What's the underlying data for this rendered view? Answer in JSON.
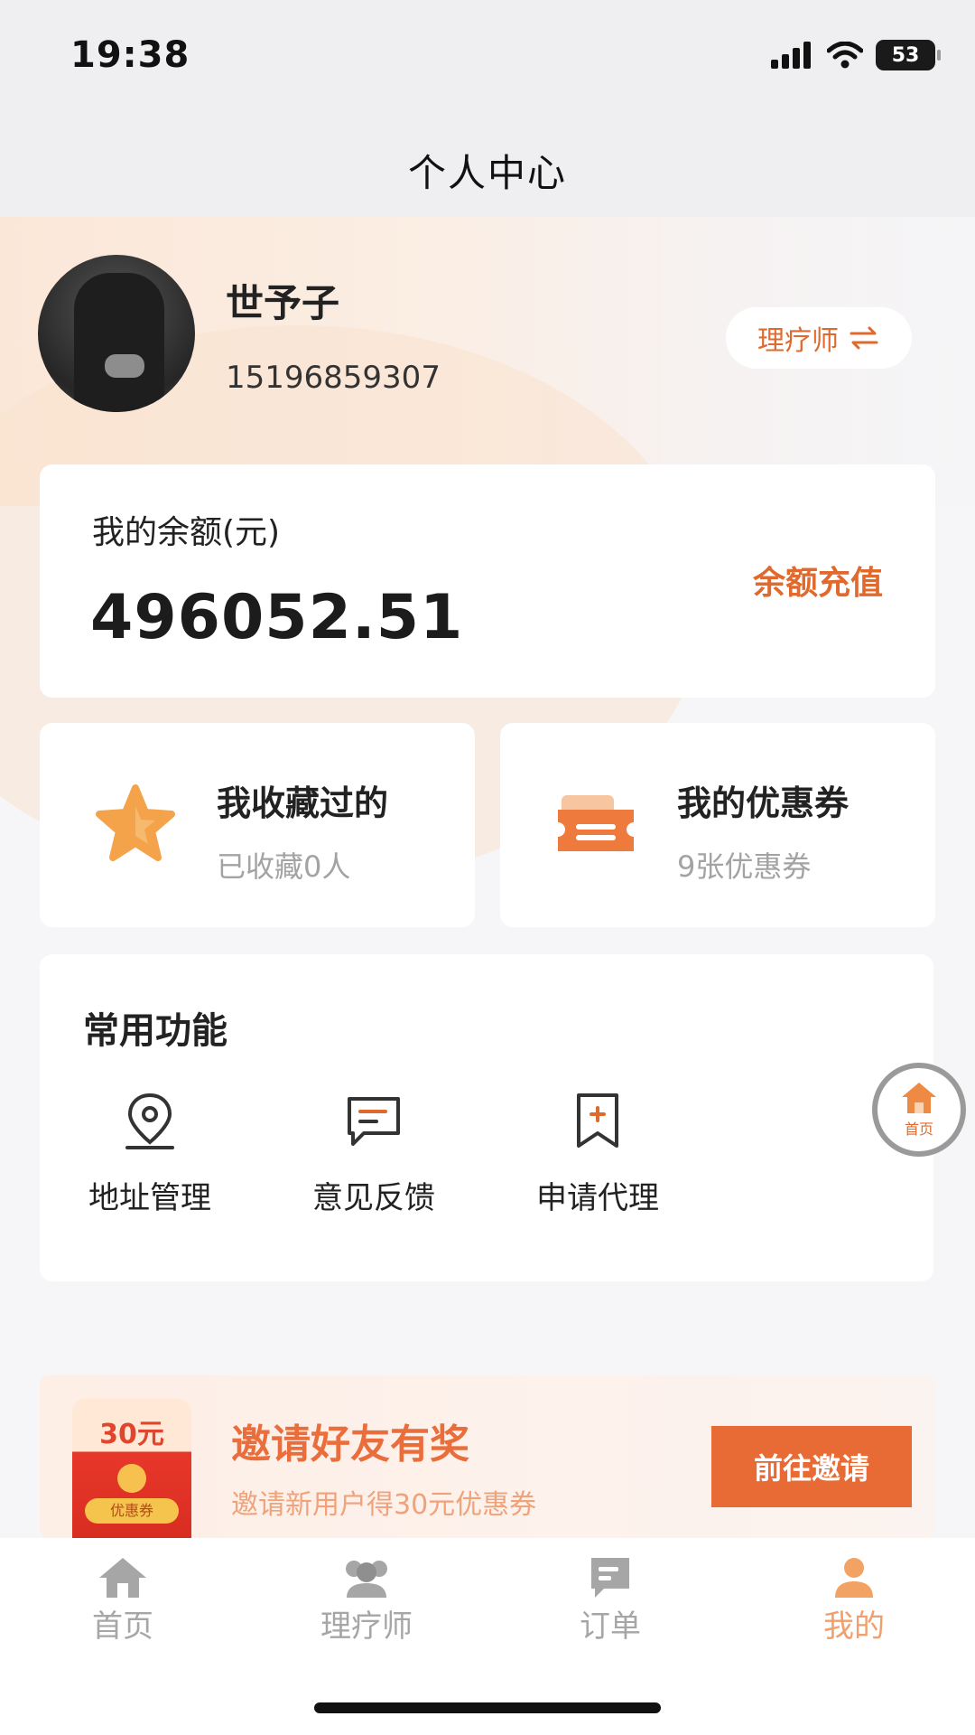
{
  "status_bar": {
    "time": "19:38",
    "battery": "53",
    "icons": [
      "cellular-signal-icon",
      "wifi-icon",
      "battery-icon"
    ]
  },
  "nav": {
    "title": "个人中心"
  },
  "profile": {
    "name": "世予子",
    "phone": "15196859307",
    "role_label": "理疗师",
    "role_icon": "swap-icon"
  },
  "balance": {
    "label": "我的余额(元)",
    "value": "496052.51",
    "recharge_label": "余额充值"
  },
  "favorites": {
    "title": "我收藏过的",
    "subtitle": "已收藏0人",
    "icon": "star-icon"
  },
  "coupons": {
    "title": "我的优惠券",
    "subtitle": "9张优惠券",
    "icon": "ticket-icon"
  },
  "functions": {
    "title": "常用功能",
    "items": [
      {
        "label": "地址管理",
        "icon": "location-pin-icon"
      },
      {
        "label": "意见反馈",
        "icon": "message-icon"
      },
      {
        "label": "申请代理",
        "icon": "bookmark-add-icon"
      }
    ]
  },
  "float_home": {
    "label": "首页",
    "icon": "home-icon"
  },
  "invite": {
    "packet_amount": "30元",
    "packet_tag": "优惠券",
    "title": "邀请好友有奖",
    "subtitle": "邀请新用户得30元优惠券",
    "button_label": "前往邀请"
  },
  "tabs": [
    {
      "label": "首页",
      "icon": "home-icon",
      "active": false
    },
    {
      "label": "理疗师",
      "icon": "people-icon",
      "active": false
    },
    {
      "label": "订单",
      "icon": "order-icon",
      "active": false
    },
    {
      "label": "我的",
      "icon": "user-icon",
      "active": true
    }
  ],
  "colors": {
    "accent": "#e06a2e",
    "accent_light": "#f0a06c",
    "invite_button": "#e86a35",
    "inactive_tab": "#a6a6a6"
  }
}
